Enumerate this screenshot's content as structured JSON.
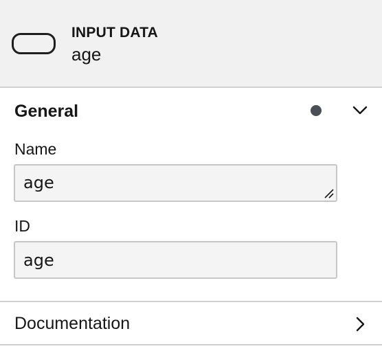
{
  "header": {
    "element_type": "INPUT DATA",
    "element_name": "age",
    "icon": "input-data-shape-icon"
  },
  "groups": [
    {
      "title": "General",
      "expanded": true,
      "has_changes": true,
      "fields": {
        "name": {
          "label": "Name",
          "value": "age"
        },
        "id": {
          "label": "ID",
          "value": "age"
        }
      }
    },
    {
      "title": "Documentation",
      "expanded": false
    }
  ],
  "colors": {
    "header_bg": "#f1f1f2",
    "field_bg": "#f4f4f4",
    "divider": "#d0d0d3",
    "dot": "#4b4f57"
  }
}
